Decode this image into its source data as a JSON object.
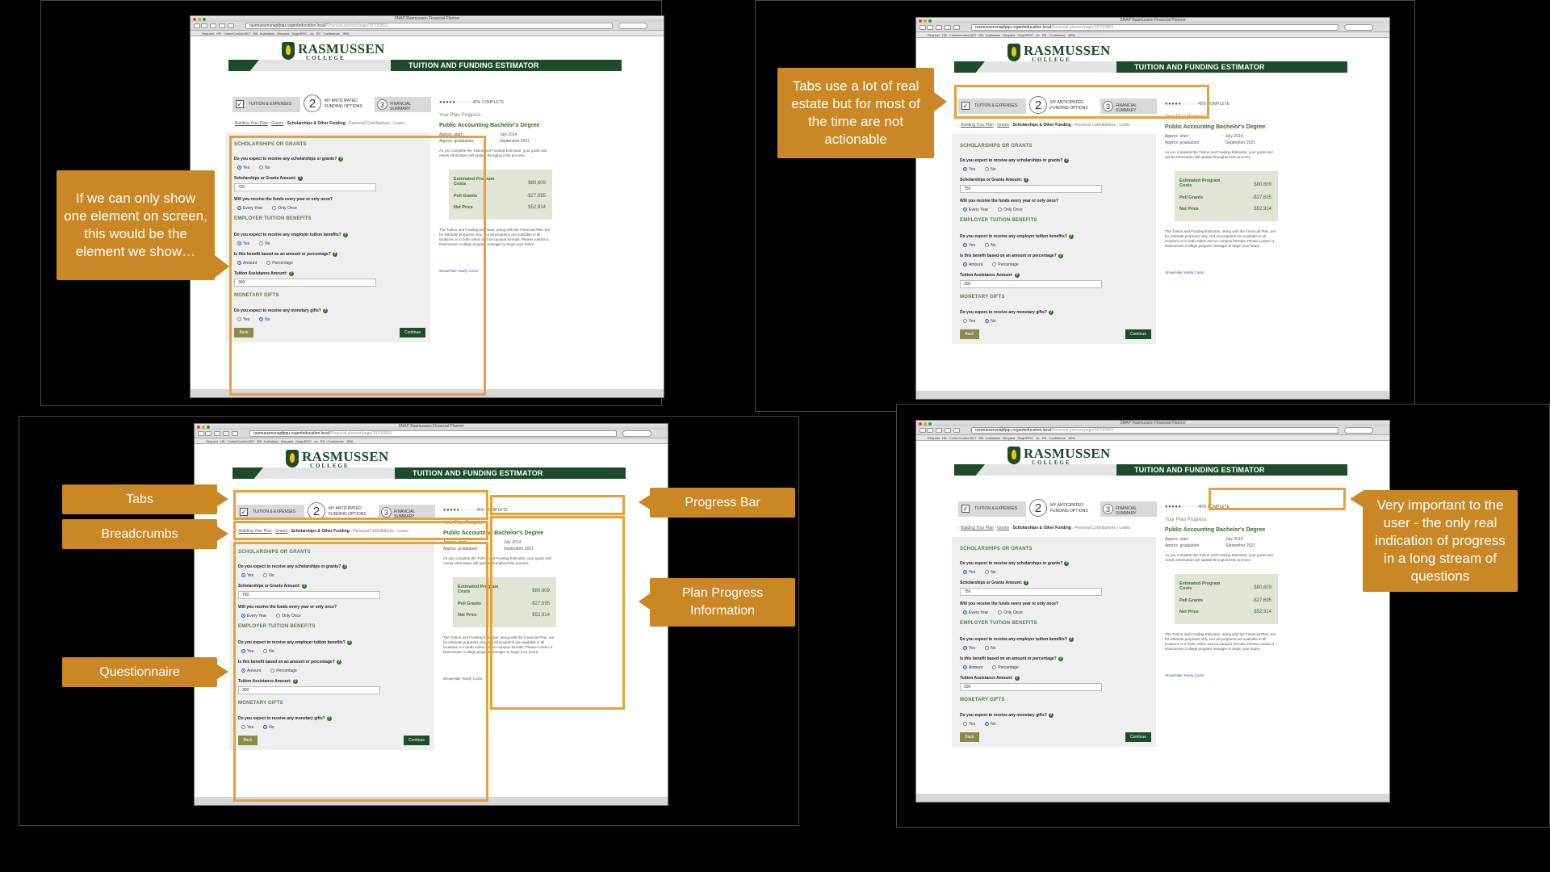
{
  "window_title": "SNAP Rasmussen Financial Planner",
  "url": "rasmussensnapfpqu.regenteducation.local",
  "url_rest": "/Financial-planner/page/1870/3803",
  "bookmarks": "Request HR   CruiseControl.NET   RB Invitations   Request Snap/RFIC on RS   Confluence   JIRA",
  "logo": {
    "name": "RASMUSSEN",
    "sub": "COLLEGE"
  },
  "header_title": "TUITION AND FUNDING ESTIMATOR",
  "tabs": {
    "tab1_label": "TUITION & EXPENSES",
    "tab2_num": "2",
    "tab2_label": "MY ANTICIPATED FUNDING OPTIONS",
    "tab3_num": "3",
    "tab3_label": "FINANCIAL SUMMARY"
  },
  "progress": {
    "dots_done": "●●●●●",
    "dots_empty": "○○○○○",
    "label": "45% COMPLETE",
    "value_percent": 45
  },
  "breadcrumbs": {
    "c1": "Building Your Plan",
    "c2": "Grants",
    "c3": "Scholarships & Other Funding",
    "c4": "Personal Contributions",
    "c5": "Loans"
  },
  "questionnaire": {
    "h1": "SCHOLARSHIPS OR GRANTS",
    "q1": "Do you expect to receive any scholarships or grants?",
    "q1_opt_yes": "Yes",
    "q1_opt_no": "No",
    "q2": "Scholarships or Grants Amount:",
    "q2_value": "750",
    "q3": "Will you receive the funds every year or only once?",
    "q3_opt1": "Every Year",
    "q3_opt2": "Only Once",
    "h2": "EMPLOYER TUITION BENEFITS",
    "q4": "Do you expect to receive any employer tuition benefits?",
    "q4_opt_yes": "Yes",
    "q4_opt_no": "No",
    "q5": "Is this benefit based on an amount or percentage?",
    "q5_opt1": "Amount",
    "q5_opt2": "Percentage",
    "q6": "Tuition Assistance Amount:",
    "q6_value": "300",
    "h3": "MONETARY GIFTS",
    "q7": "Do you expect to receive any monetary gifts?",
    "q7_opt_yes": "Yes",
    "q7_opt_no": "No",
    "back": "Back",
    "continue": "Continue",
    "help_glyph": "?"
  },
  "plan": {
    "title": "Your Plan Progress",
    "degree": "Public Accounting Bachelor's Degree",
    "start_label": "Approx. start:",
    "start_value": "July 2014",
    "grad_label": "Approx. graduation:",
    "grad_value": "September 2021",
    "note": "As you complete the Tuition and Funding Estimator, your goals and needs information will update throughout the process.",
    "cost_label": "Estimated Program Costs",
    "cost_value": "$80,609",
    "pell_label": "Pell Grants",
    "pell_value": "-$27,695",
    "net_label": "Net Price",
    "net_value": "$52,914",
    "desc": "The Tuition and Funding Estimator, along with the Financial Plan, are for estimate purposes only. Not all programs are available in all locations or in both online and on-campus formats. Please contact a Rasmussen College program manager to begin your future.",
    "link": "Show/Hide Yearly Costs"
  },
  "callouts": {
    "tl": "If we can only show one element on screen, this would be the element we show…",
    "tr": "Tabs use a lot of real estate but for most of the time are not actionable",
    "tabs": "Tabs",
    "breadcrumbs": "Breadcrumbs",
    "questionnaire": "Questionnaire",
    "progress_bar": "Progress Bar",
    "plan_info": "Plan Progress Information",
    "br": "Very important to the user - the only real indication of progress in a long stream of questions"
  },
  "colors": {
    "callout": "#c98726",
    "highlight": "#e8a13a",
    "brand_green": "#1e4c2a"
  }
}
